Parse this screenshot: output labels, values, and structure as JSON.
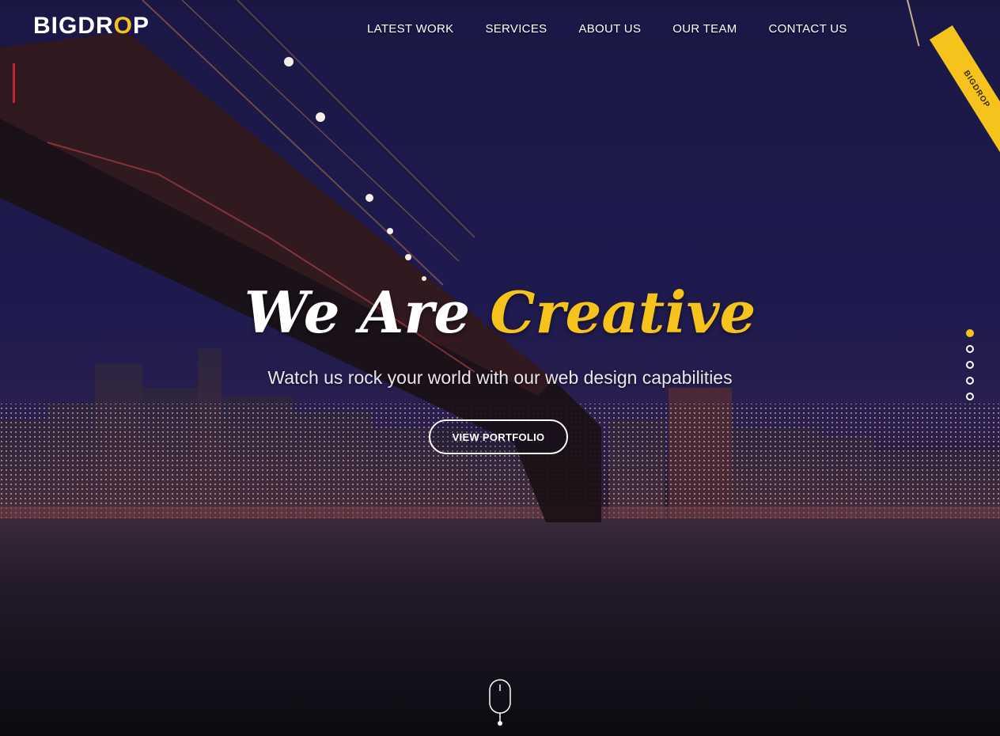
{
  "header": {
    "logo_prefix": "BIGDR",
    "logo_o": "O",
    "logo_suffix": "P",
    "nav": [
      {
        "label": "LATEST WORK"
      },
      {
        "label": "SERVICES"
      },
      {
        "label": "ABOUT US"
      },
      {
        "label": "OUR TEAM"
      },
      {
        "label": "CONTACT US"
      }
    ],
    "tag_label": "BIGDROP"
  },
  "hero": {
    "headline_white": "We Are ",
    "headline_yellow": "Creative",
    "subline": "Watch us rock your world with our web design capabilities",
    "cta_label": "VIEW PORTFOLIO"
  },
  "slider": {
    "count": 5,
    "active_index": 0
  },
  "colors": {
    "accent": "#f6c21c",
    "sky": "#1b1745",
    "text": "#ffffff"
  },
  "icons": {
    "scroll": "mouse-icon"
  }
}
